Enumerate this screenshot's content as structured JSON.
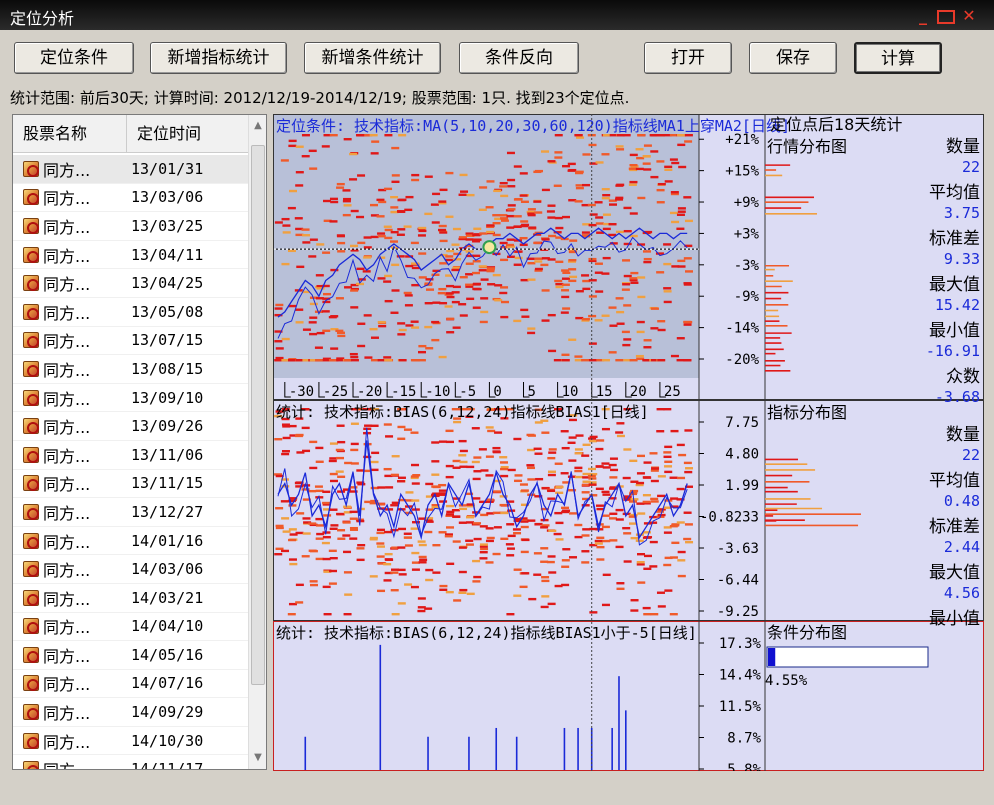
{
  "window": {
    "title": "定位分析"
  },
  "toolbar": {
    "buttons": [
      {
        "label": "定位条件"
      },
      {
        "label": "新增指标统计"
      },
      {
        "label": "新增条件统计"
      },
      {
        "label": "条件反向"
      },
      {
        "label": "打开"
      },
      {
        "label": "保存"
      },
      {
        "label": "计算"
      }
    ]
  },
  "status_text": "统计范围: 前后30天; 计算时间: 2012/12/19-2014/12/19; 股票范围: 1只. 找到23个定位点.",
  "list": {
    "headers": [
      "股票名称",
      "定位时间"
    ],
    "rows": [
      {
        "name": "同方...",
        "date": "13/01/31"
      },
      {
        "name": "同方...",
        "date": "13/03/06"
      },
      {
        "name": "同方...",
        "date": "13/03/25"
      },
      {
        "name": "同方...",
        "date": "13/04/11"
      },
      {
        "name": "同方...",
        "date": "13/04/25"
      },
      {
        "name": "同方...",
        "date": "13/05/08"
      },
      {
        "name": "同方...",
        "date": "13/07/15"
      },
      {
        "name": "同方...",
        "date": "13/08/15"
      },
      {
        "name": "同方...",
        "date": "13/09/10"
      },
      {
        "name": "同方...",
        "date": "13/09/26"
      },
      {
        "name": "同方...",
        "date": "13/11/06"
      },
      {
        "name": "同方...",
        "date": "13/11/15"
      },
      {
        "name": "同方...",
        "date": "13/12/27"
      },
      {
        "name": "同方...",
        "date": "14/01/16"
      },
      {
        "name": "同方...",
        "date": "14/03/06"
      },
      {
        "name": "同方...",
        "date": "14/03/21"
      },
      {
        "name": "同方...",
        "date": "14/04/10"
      },
      {
        "name": "同方...",
        "date": "14/05/16"
      },
      {
        "name": "同方...",
        "date": "14/07/16"
      },
      {
        "name": "同方...",
        "date": "14/09/29"
      },
      {
        "name": "同方...",
        "date": "14/10/30"
      },
      {
        "name": "同方...",
        "date": "14/11/17"
      }
    ]
  },
  "chart_data": [
    {
      "type": "heatmap",
      "title": "定位条件: 技术指标:MA(5,10,20,30,60,120)指标线MA1上穿MA2[日线]",
      "x_ticks": [
        -30,
        -25,
        -20,
        -15,
        -10,
        -5,
        0,
        5,
        10,
        15,
        20,
        25
      ],
      "xlim": [
        -31,
        30
      ],
      "y_ticks": [
        "+21%",
        "+15%",
        "+9%",
        "+3%",
        "-3%",
        "-9%",
        "-14%",
        "-20%"
      ],
      "ylim": [
        -21,
        22
      ],
      "marker_x": 15,
      "series": [
        {
          "values": [
            -13,
            -12,
            -10,
            -8,
            -6,
            -7,
            -9,
            -6,
            -5,
            -3,
            -2,
            -1,
            -2,
            -4,
            -3,
            -1,
            0,
            1,
            0,
            -1,
            -2,
            -4,
            -3,
            -2,
            -1,
            -3,
            -2,
            0,
            1,
            0,
            0,
            1,
            2,
            2,
            3,
            2,
            1,
            2,
            3,
            3,
            4,
            3,
            2,
            3,
            3,
            2,
            3,
            4,
            3,
            2,
            3,
            2,
            3,
            4,
            3,
            2,
            3,
            3,
            2,
            3,
            3
          ]
        }
      ],
      "side_panel": {
        "title": "定位点后18天统计",
        "subtitle": "行情分布图",
        "stats": [
          {
            "label": "数量",
            "value": "22"
          },
          {
            "label": "平均值",
            "value": "3.75"
          },
          {
            "label": "标准差",
            "value": "9.33"
          },
          {
            "label": "最大值",
            "value": "15.42"
          },
          {
            "label": "最小值",
            "value": "-16.91"
          },
          {
            "label": "众数",
            "value": "-3.68"
          }
        ]
      }
    },
    {
      "type": "heatmap",
      "title": "统计: 技术指标:BIAS(6,12,24)指标线BIAS1[日线]",
      "y_ticks": [
        "7.75",
        "4.80",
        "1.99",
        "-0.8233",
        "-3.63",
        "-6.44",
        "-9.25"
      ],
      "ylim": [
        -10,
        9
      ],
      "series": [
        {
          "values": [
            1,
            2,
            0,
            1,
            3,
            -1,
            0,
            -2,
            1,
            2,
            0,
            3,
            -1,
            6,
            1,
            -1,
            0,
            -2,
            1,
            0,
            -1,
            -3,
            0,
            1,
            -1,
            2,
            1,
            0,
            2,
            -1,
            0,
            1,
            3,
            1,
            0,
            -2,
            -1,
            1,
            2,
            0,
            -1,
            1,
            0,
            3,
            -1,
            0,
            1,
            -2,
            0,
            1,
            2,
            -1,
            0,
            -3,
            -2,
            -1,
            0,
            1,
            -1,
            0,
            2
          ]
        }
      ],
      "side_panel": {
        "subtitle": "指标分布图",
        "stats": [
          {
            "label": "数量",
            "value": "22"
          },
          {
            "label": "平均值",
            "value": "0.48"
          },
          {
            "label": "标准差",
            "value": "2.44"
          },
          {
            "label": "最大值",
            "value": "4.56"
          },
          {
            "label": "最小值",
            "value": ""
          }
        ]
      }
    },
    {
      "type": "bar",
      "title": "统计: 技术指标:BIAS(6,12,24)指标线BIAS1小于-5[日线]",
      "y_ticks": [
        "17.3%",
        "14.4%",
        "11.5%",
        "8.7%",
        "5.8%"
      ],
      "ylim": [
        4.5,
        17.6
      ],
      "x": [
        -27,
        -16,
        -9,
        -3,
        1,
        4,
        11,
        13,
        15,
        18,
        19,
        20
      ],
      "values": [
        7.8,
        17.2,
        7.8,
        7.8,
        8.7,
        7.8,
        8.7,
        8.7,
        8.7,
        8.7,
        14,
        10.5
      ],
      "side_panel": {
        "subtitle": "条件分布图",
        "bar_fraction": 0.0455,
        "bar_label": "4.55%"
      }
    }
  ],
  "colors": {
    "panel1_bg": "#b8c0d8",
    "panel_bg": "#dcdcf4",
    "heat_hi": "#e01818",
    "heat_mid": "#f05a2a",
    "heat_low": "#f0a040",
    "blue_line": "#1a2ad8",
    "marker_line": "#444444",
    "border_red": "#c82020"
  }
}
